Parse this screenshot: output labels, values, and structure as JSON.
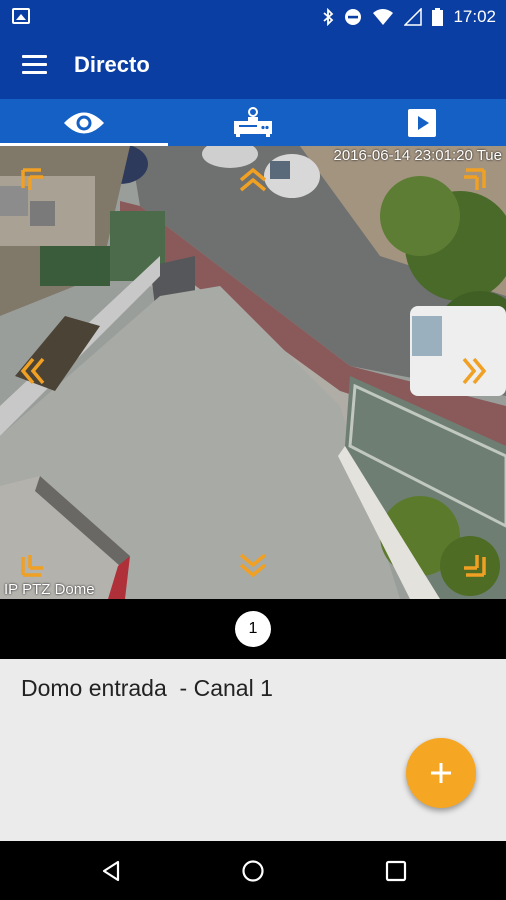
{
  "status_bar": {
    "time": "17:02",
    "icons": [
      "image-icon",
      "bluetooth-icon",
      "do-not-disturb-icon",
      "wifi-icon",
      "cell-signal-icon",
      "battery-icon"
    ]
  },
  "app_bar": {
    "title": "Directo",
    "menu_icon": "hamburger-menu-icon"
  },
  "tabs": [
    {
      "name": "live-view",
      "icon": "eye-icon",
      "selected": true
    },
    {
      "name": "recorder",
      "icon": "dvr-icon",
      "selected": false
    },
    {
      "name": "playback",
      "icon": "play-icon",
      "selected": false
    }
  ],
  "camera": {
    "timestamp": "2016-06-14 23:01:20 Tue",
    "label": "IP PTZ Dome",
    "ptz_controls": [
      "up-left",
      "up",
      "up-right",
      "left",
      "right",
      "down-left",
      "down",
      "down-right"
    ]
  },
  "pager": {
    "current_page": "1"
  },
  "channel": {
    "name": "Domo entrada  - Canal 1"
  },
  "fab": {
    "icon": "plus-icon"
  },
  "nav_bar": {
    "icons": [
      "back-icon",
      "home-icon",
      "recents-icon"
    ]
  },
  "colors": {
    "app_bar": "#0a3ea2",
    "tab_bar": "#1460c4",
    "accent": "#f5a623",
    "ptz_arrow": "#f0a023"
  }
}
